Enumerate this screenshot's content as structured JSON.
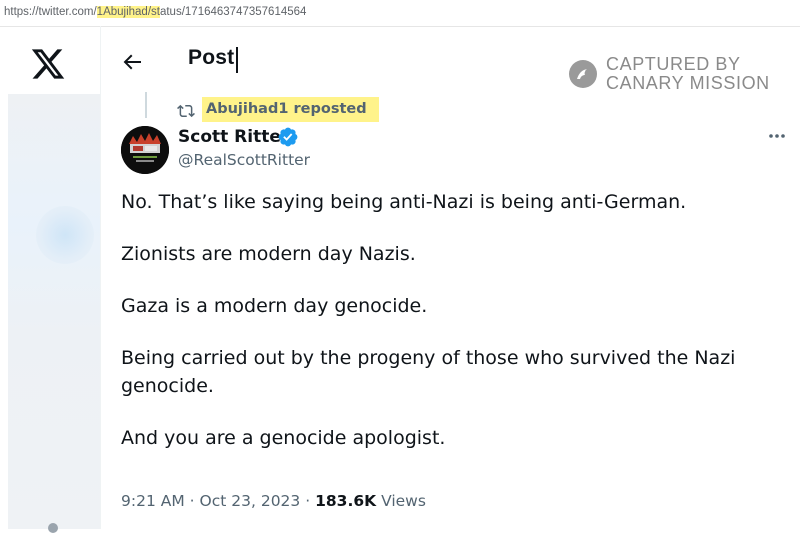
{
  "browser": {
    "url_prefix": "https://twitter.com/",
    "url_handle": "1Abujihad",
    "url_path_hl": "/st",
    "url_suffix": "atus/1716463747357614564"
  },
  "header": {
    "title": "Post",
    "back_icon": "arrow-left-icon",
    "logo_icon": "x-logo-icon"
  },
  "watermark": {
    "line1": "CAPTURED BY",
    "line2": "CANARY MISSION",
    "icon": "canary-bird-icon"
  },
  "repost": {
    "label": "Abujihad1 reposted",
    "icon": "repost-icon"
  },
  "author": {
    "name": "Scott Ritter",
    "handle": "@RealScottRitter",
    "verified_icon": "verified-badge-icon",
    "more_icon": "more-horizontal-icon"
  },
  "tweet": {
    "paragraphs": [
      "No. That’s like saying being anti-Nazi is being anti-German.",
      "Zionists are modern day Nazis.",
      "Gaza is a modern day genocide.",
      "Being carried out by the progeny of those who survived the Nazi genocide.",
      "And you are a genocide apologist."
    ],
    "time": "9:21 AM",
    "separator": "·",
    "date": "Oct 23, 2023",
    "views_count": "183.6K",
    "views_label": "Views"
  },
  "colors": {
    "highlight": "#fff38a",
    "text_primary": "#0f1419",
    "text_secondary": "#536471",
    "verified_blue": "#1d9bf0",
    "watermark_gray": "#8a8a8a"
  }
}
